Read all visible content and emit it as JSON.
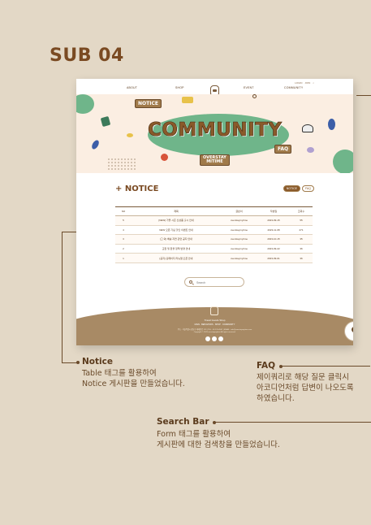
{
  "page_title": "SUB 04",
  "site": {
    "util_links": [
      "LOGIN",
      "JOIN"
    ],
    "nav": {
      "about": "ABOUT",
      "shop": "SHOP",
      "event": "EVENT",
      "community": "COMMUNITY"
    },
    "banner": {
      "heading": "COMMUNITY",
      "tag_notice": "NOTICE",
      "tag_faq": "FAQ",
      "tag_overstay_1": "OVERSTAY",
      "tag_overstay_2": "MITIME"
    },
    "notice_heading": "+ NOTICE",
    "tabs": {
      "notice": "NOTICE",
      "faq": "FAQ"
    },
    "table": {
      "headers": [
        "NO",
        "제목",
        "글쓴이",
        "작성일",
        "조회수"
      ],
      "rows": [
        {
          "no": "5",
          "title": "[NEW] 가을 시즌 신상품 출시 안내",
          "writer": "overstaymytime",
          "date": "2023-09-15",
          "views": "55"
        },
        {
          "no": "4",
          "title": "NEW 오픈 기념 할인 이벤트 안내",
          "writer": "overstaymytime",
          "date": "2023-11-08",
          "views": "271"
        },
        {
          "no": "3",
          "title": "[그 외] 배송 지연 관련 공지 안내",
          "writer": "overstaymytime",
          "date": "2023-10-15",
          "views": "35"
        },
        {
          "no": "2",
          "title": "교환 및 환불 정책 변경 안내",
          "writer": "overstaymytime",
          "date": "2023-09-22",
          "views": "36"
        },
        {
          "no": "1",
          "title": "[공지] 홈페이지 리뉴얼 오픈 안내",
          "writer": "overstaymytime",
          "date": "2023-09-01",
          "views": "36"
        }
      ]
    },
    "search_placeholder": "Search",
    "footer": {
      "name": "Travel Goods Shop",
      "links": "MAIN  ·  BEHAVIORS  ·  SHOP  ·  COMMUNITY",
      "info": "주소 : 서울특별시 강남구 테헤란로 123  |  TEL : 02-123-4567  |  EMAIL : info@overstaymytime.com",
      "copyright": "Copyright © 2023 overstaymytime All rights reserved."
    }
  },
  "annotations": {
    "notice": {
      "title": "Notice",
      "line1": "Table 태그를 활용하여",
      "line2": "Notice 게시판을 만들었습니다."
    },
    "faq": {
      "title": "FAQ",
      "line1": "제이쿼리로 해당 질문 클릭시",
      "line2": "아코디언처럼 답변이 나오도록",
      "line3": "하였습니다."
    },
    "search": {
      "title": "Search Bar",
      "line1": "Form 태그를 활용하여",
      "line2": "게시판에 대한 검색창을 만들었습니다."
    }
  },
  "colors": {
    "background": "#e3d8c6",
    "brown": "#7a4a22",
    "footer": "#a88a65",
    "green": "#6fb58a"
  }
}
